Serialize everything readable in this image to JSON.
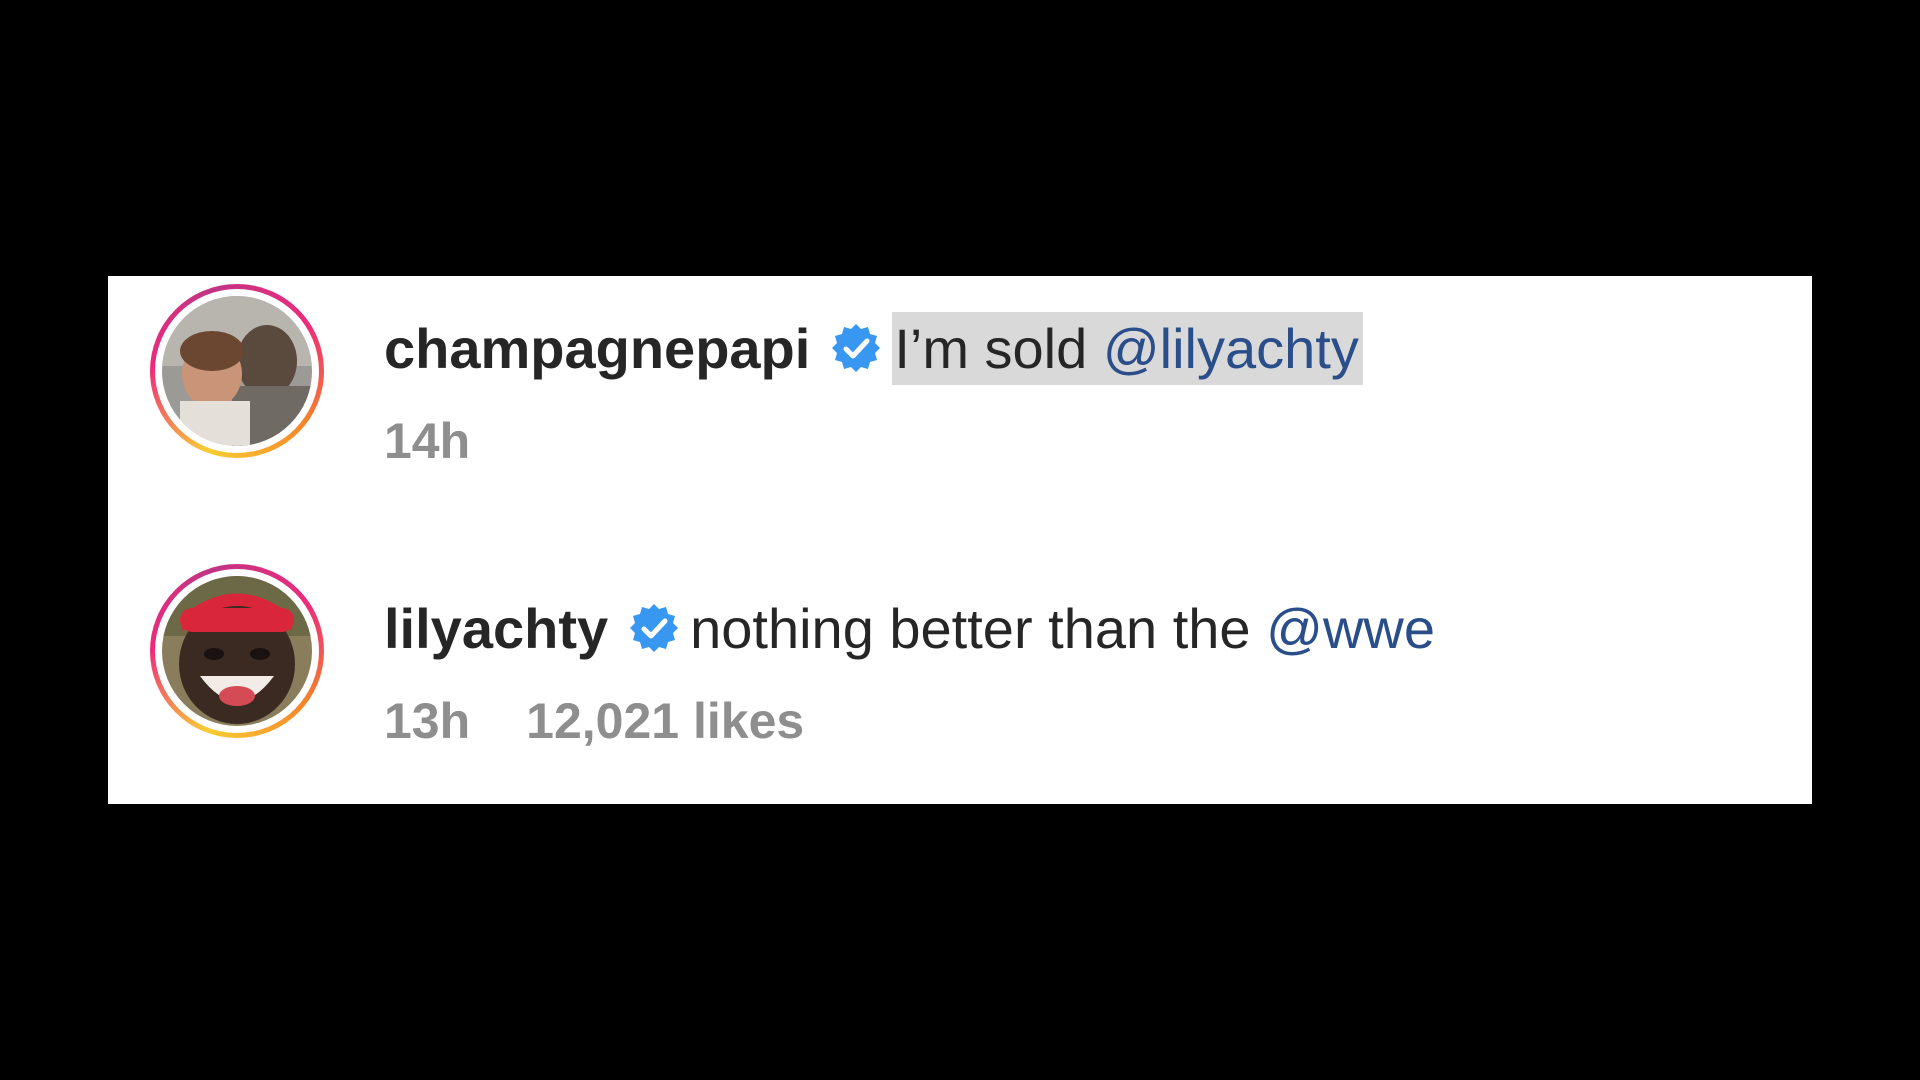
{
  "comments": [
    {
      "username": "champagnepapi",
      "verified": true,
      "text": "I’m sold",
      "mention": "@lilyachty",
      "time": "14h"
    },
    {
      "username": "lilyachty",
      "verified": true,
      "text": "nothing better than the",
      "mention": "@wwe",
      "time": "13h",
      "likes": "12,021 likes"
    }
  ],
  "colors": {
    "verified_badge": "#3897f0",
    "mention": "#2a4e8a",
    "meta_text": "#8e8e8e",
    "highlight": "#d9d9d9"
  },
  "icons": {
    "verified": "verified-badge-icon"
  }
}
